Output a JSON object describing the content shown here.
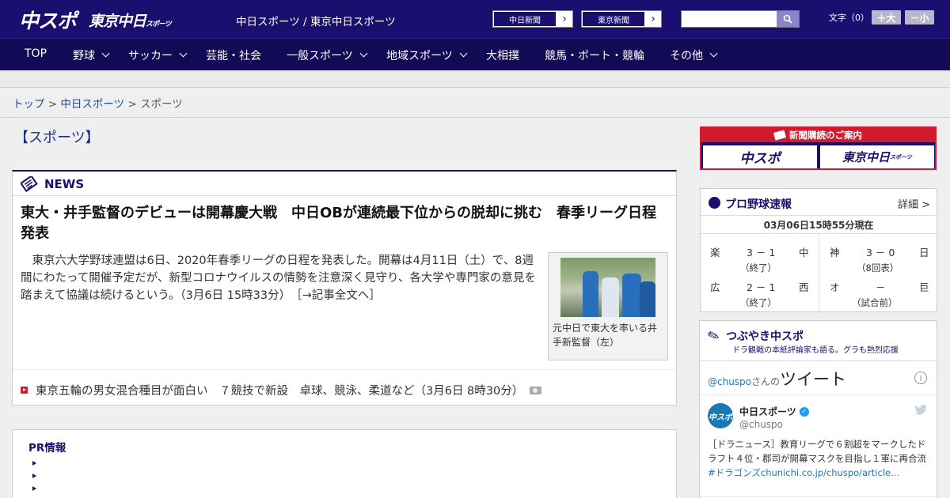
{
  "header": {
    "logo_main": "中スポ",
    "logo_tokyo": "東京中日",
    "logo_tokyo_small": "スポーツ",
    "site_name": "中日スポーツ / 東京中日スポーツ",
    "btn_chunichi": "中日新聞",
    "btn_tokyo": "東京新聞",
    "search_placeholder": "",
    "font_size_label": "文字（0）",
    "font_larger": "＋大",
    "font_smaller": "－小"
  },
  "nav": {
    "top": "TOP",
    "baseball": "野球",
    "soccer": "サッカー",
    "entertainment": "芸能・社会",
    "general_sports": "一般スポーツ",
    "regional_sports": "地域スポーツ",
    "sumo": "大相撲",
    "racing": "競馬・ボート・競輪",
    "others": "その他"
  },
  "breadcrumb": {
    "home": "トップ",
    "sep1": ">",
    "section": "中日スポーツ",
    "sep2": ">",
    "current": "スポーツ"
  },
  "page_title": "【スポーツ】",
  "news": {
    "label": "NEWS",
    "headline": "東大・井手監督のデビューは開幕慶大戦　中日OBが連続最下位からの脱却に挑む　春季リーグ日程発表",
    "body": "東京六大学野球連盟は6日、2020年春季リーグの日程を発表した。開幕は4月11日（土）で、8週間にわたって開催予定だが、新型コロナウイルスの情勢を注意深く見守り、各大学や専門家の意見を踏まえて協議は続けるという。（3月6日 15時33分）　［→記事全文へ］",
    "photo_caption": "元中日で東大を率いる井手新監督（左）",
    "sub_article": "東京五輪の男女混合種目が面白い　７競技で新設　卓球、競泳、柔道など（3月6日 8時30分）"
  },
  "pr": {
    "label": "PR情報",
    "items": [
      "",
      "",
      ""
    ]
  },
  "subscribe": {
    "header": "新聞購読のご案内",
    "logo_main": "中スポ",
    "logo_tokyo": "東京中日",
    "logo_tokyo_small": "スポーツ"
  },
  "baseball": {
    "title": "プロ野球速報",
    "more": "詳細 >",
    "timestamp": "03月06日15時55分現在",
    "games": [
      {
        "home": "楽",
        "score": "3 － 1",
        "away": "中",
        "status": "（終了）"
      },
      {
        "home": "神",
        "score": "3 － 0",
        "away": "日",
        "status": "（8回表）"
      },
      {
        "home": "広",
        "score": "2 － 1",
        "away": "西",
        "status": "（終了）"
      },
      {
        "home": "オ",
        "score": "－",
        "away": "巨",
        "status": "（試合前）"
      }
    ]
  },
  "tweets": {
    "title": "つぶやき中スポ",
    "subtitle": "ドラ観戦の本紙評論家も語る。グラも熱烈応援",
    "handle_prefix": "@chuspo",
    "handle_suffix": "さんの",
    "heading": "ツイート",
    "info": "i",
    "account_name": "中日スポーツ",
    "account_handle": "@chuspo",
    "avatar_text": "中スポ",
    "tweet_text": "［ドラニュース］教育リーグで６割超をマークしたドラフト４位・郡司が開幕マスクを目指し１軍に再合流",
    "tweet_link": "#ドラゴンズchunichi.co.jp/chuspo/article…"
  },
  "colors": {
    "brand_navy": "#1a0e6e",
    "accent_red": "#d01a2d",
    "link_blue": "#1d4aa8"
  }
}
